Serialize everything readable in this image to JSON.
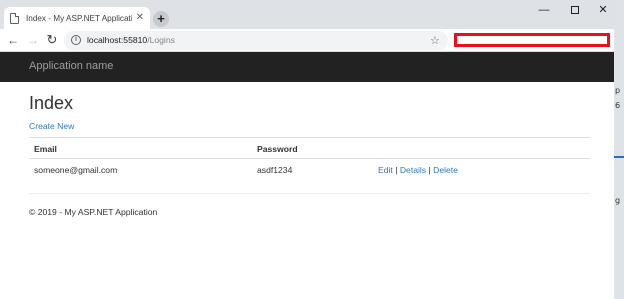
{
  "browser": {
    "tab": {
      "title": "Index - My ASP.NET Application",
      "close_glyph": "✕",
      "icon": "document-icon"
    },
    "new_tab_glyph": "+",
    "window_controls": {
      "minimize_glyph": "—",
      "close_glyph": "✕"
    },
    "nav": {
      "back_glyph": "←",
      "forward_glyph": "→",
      "reload_glyph": "↻"
    },
    "address": {
      "host": "localhost:55810",
      "path": "/Logins",
      "info_glyph": "i"
    },
    "bookmark_glyph": "☆",
    "annotation_color": "#e8101f"
  },
  "app": {
    "brand": "Application name",
    "page_title": "Index",
    "create_link": "Create New",
    "table": {
      "headers": [
        "Email",
        "Password"
      ],
      "rows": [
        {
          "email": "someone@gmail.com",
          "password": "asdf1234",
          "actions": [
            "Edit",
            "Details",
            "Delete"
          ],
          "separator": "|"
        }
      ]
    },
    "footer": "© 2019 - My ASP.NET Application",
    "colors": {
      "navbar": "#222222",
      "link": "#337ab7",
      "text": "#333333"
    }
  },
  "desktop": {
    "fragments": [
      "p",
      "6",
      "g"
    ]
  }
}
